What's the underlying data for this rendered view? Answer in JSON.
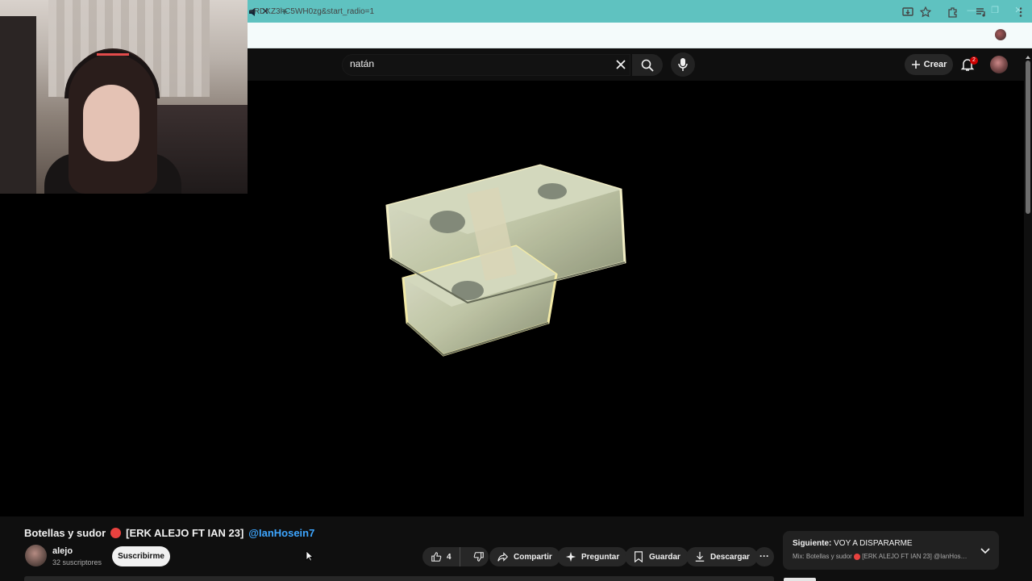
{
  "browser": {
    "url": "=RDKZ3hC5WH0zg&start_radio=1",
    "tab_close_icon": "close-icon",
    "new_tab_icon": "plus-icon"
  },
  "youtube": {
    "search": {
      "value": "natán"
    },
    "create_label": "Crear",
    "notification_count": "2"
  },
  "video": {
    "title": "Botellas y sudor",
    "title_suffix": "[ERK ALEJO FT IAN 23]",
    "mention": "@IanHosein7",
    "channel": {
      "name": "alejo",
      "subscribers": "32 suscriptores",
      "subscribe_label": "Suscribirme"
    },
    "actions": {
      "likes": "4",
      "share": "Compartir",
      "ask": "Preguntar",
      "save": "Guardar",
      "download": "Descargar"
    }
  },
  "next_up": {
    "label": "Siguiente:",
    "title": "VOY A DISPARARME",
    "mix": "Mix: Botellas y sudor",
    "mix_suffix": "[ERK ALEJO FT IAN 23] @IanHosei..."
  },
  "colors": {
    "tabbar": "#5fc2c0",
    "accent_link": "#3ea6ff",
    "badge": "#cc0000"
  }
}
